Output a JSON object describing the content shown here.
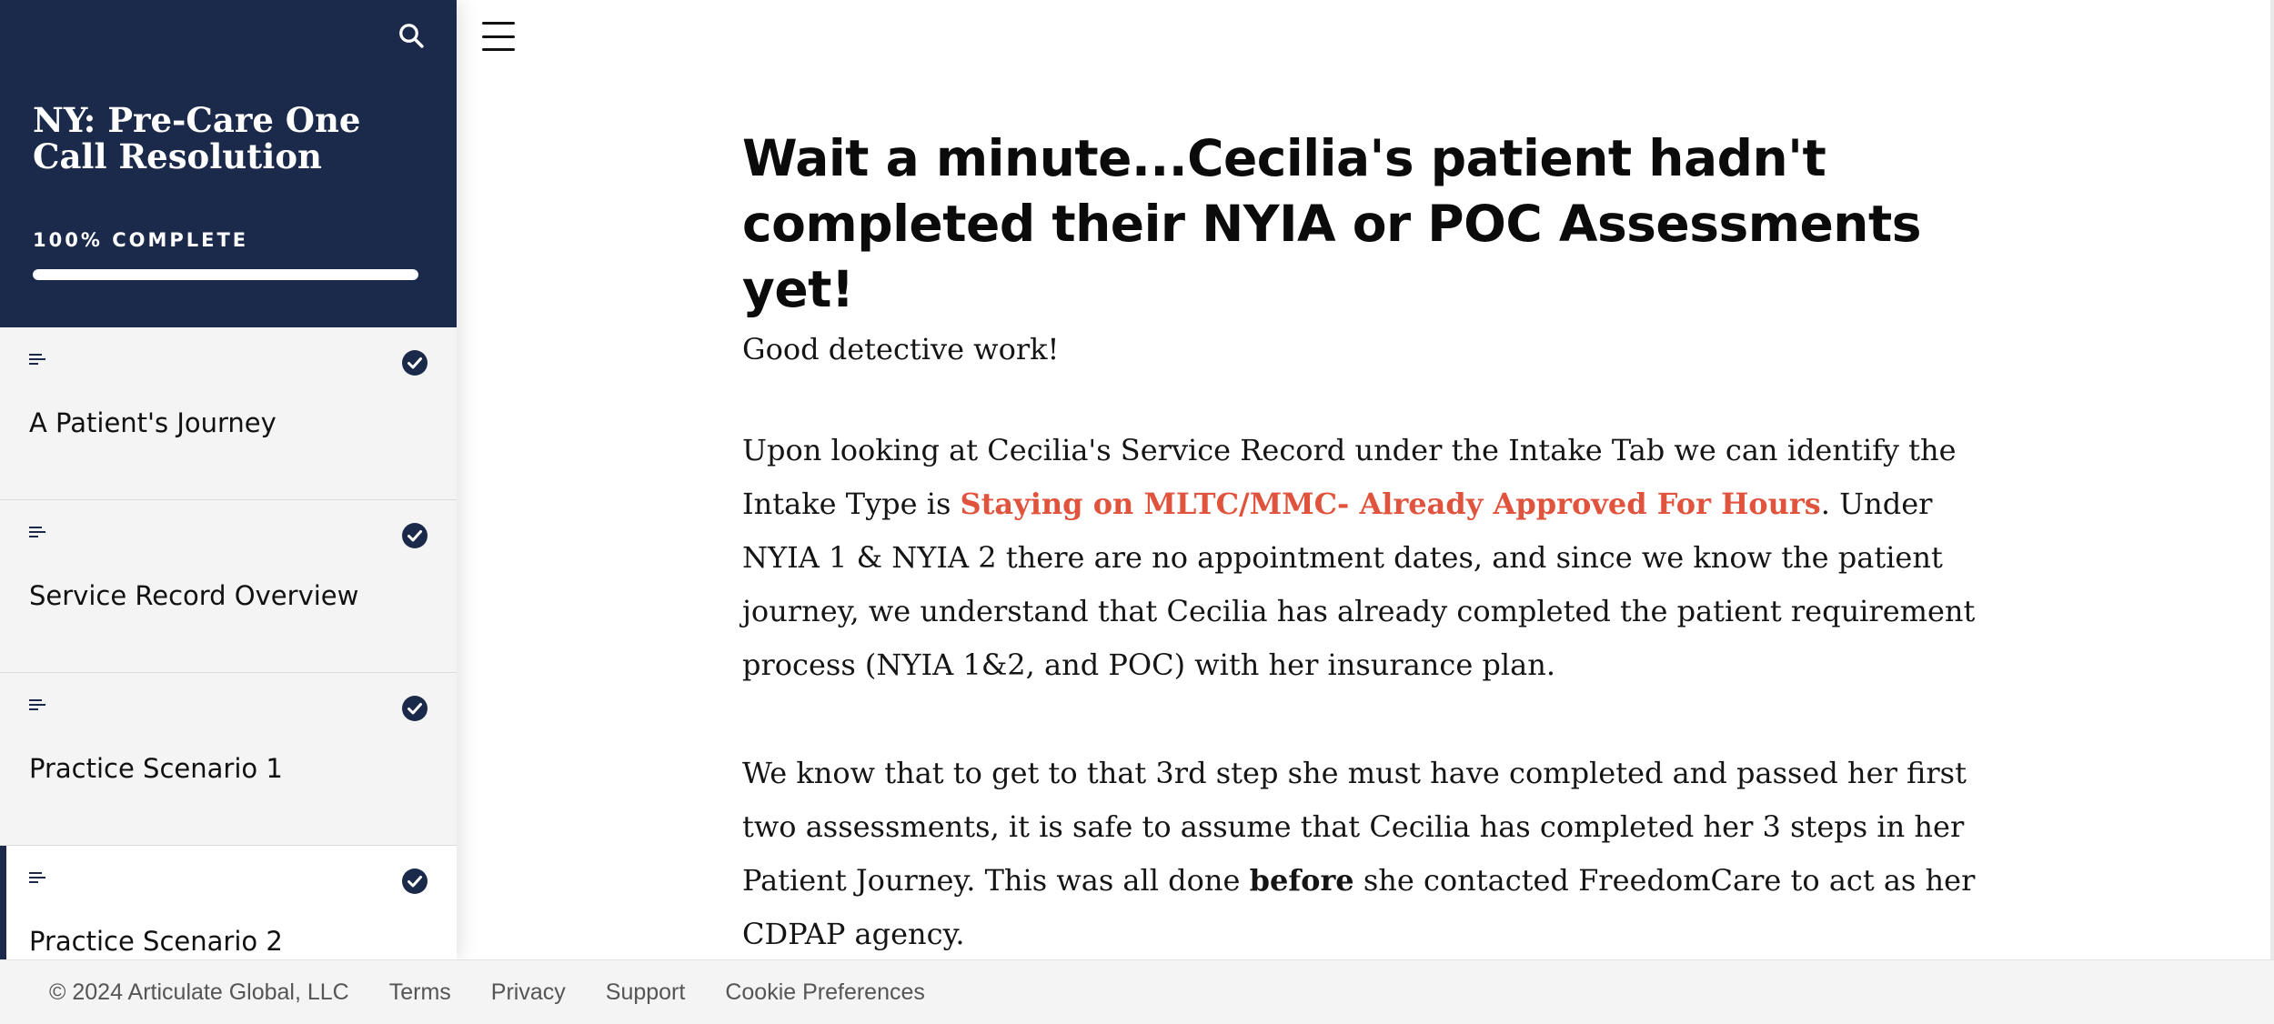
{
  "course": {
    "title": "NY: Pre-Care One Call Resolution",
    "progress_label": "100% COMPLETE",
    "progress_fraction": 1.0
  },
  "colors": {
    "sidebar_header": "#1b2a4a",
    "highlight": "#e0533d",
    "check": "#1b2a4a"
  },
  "icons": {
    "search": "search-icon",
    "menu": "hamburger-menu-icon",
    "lesson_type": "text-lines-icon",
    "complete": "check-circle-icon"
  },
  "lessons": [
    {
      "title": "A Patient's Journey",
      "complete": true
    },
    {
      "title": "Service Record Overview",
      "complete": true
    },
    {
      "title": "Practice Scenario 1",
      "complete": true
    },
    {
      "title": "Practice Scenario 2",
      "complete": true
    }
  ],
  "main": {
    "heading": "Wait a minute...Cecilia's patient hadn't completed their NYIA or POC Assessments yet!",
    "lead": "Good detective work!",
    "p1_before": "Upon looking at Cecilia's Service Record under the Intake Tab we can identify the Intake Type is ",
    "p1_highlight": "Staying on MLTC/MMC- Already Approved For Hours",
    "p1_after": ". Under NYIA 1 & NYIA 2 there are no appointment dates, and since we know the patient journey, we understand that Cecilia has already completed the patient requirement process (NYIA 1&2, and POC) with her insurance plan.",
    "p2_before": "We know that to get to that 3rd step she must have completed and passed her first two assessments, it is safe to assume that Cecilia has completed her 3 steps in her Patient Journey.  This was all done ",
    "p2_bold": "before",
    "p2_after": " she contacted FreedomCare to act as her CDPAP agency."
  },
  "footer": {
    "copyright": "© 2024 Articulate Global, LLC",
    "links": [
      "Terms",
      "Privacy",
      "Support",
      "Cookie Preferences"
    ]
  }
}
